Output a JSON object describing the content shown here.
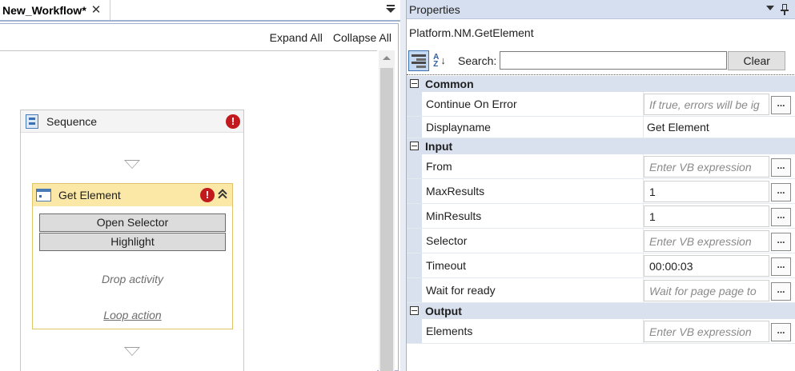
{
  "designer": {
    "tab_title": "New_Workflow*",
    "tab_close": "✕",
    "toolbar": {
      "expand_all": "Expand All",
      "collapse_all": "Collapse All"
    },
    "sequence": {
      "title": "Sequence",
      "error": "!"
    },
    "activity": {
      "title": "Get Element",
      "error": "!",
      "open_selector": "Open Selector",
      "highlight": "Highlight",
      "drop_activity": "Drop activity",
      "loop_action": "Loop action"
    }
  },
  "properties": {
    "panel_title": "Properties",
    "type_name": "Platform.NM.GetElement",
    "search": {
      "label": "Search:",
      "value": "",
      "clear_label": "Clear"
    },
    "ellipsis": "...",
    "categories": [
      {
        "name": "Common",
        "rows": [
          {
            "label": "Continue On Error",
            "value": "If true, errors will be ig",
            "placeholder": true,
            "has_button": true
          },
          {
            "label": "Displayname",
            "value": "Get Element",
            "placeholder": false,
            "has_button": false
          }
        ]
      },
      {
        "name": "Input",
        "rows": [
          {
            "label": "From",
            "value": "Enter VB expression",
            "placeholder": true,
            "has_button": true
          },
          {
            "label": "MaxResults",
            "value": "1",
            "placeholder": false,
            "has_button": true
          },
          {
            "label": "MinResults",
            "value": "1",
            "placeholder": false,
            "has_button": true
          },
          {
            "label": "Selector",
            "value": "Enter VB expression",
            "placeholder": true,
            "has_button": true
          },
          {
            "label": "Timeout",
            "value": "00:00:03",
            "placeholder": false,
            "has_button": true
          },
          {
            "label": "Wait for ready",
            "value": "Wait for page page to",
            "placeholder": true,
            "has_button": true
          }
        ]
      },
      {
        "name": "Output",
        "rows": [
          {
            "label": "Elements",
            "value": "Enter VB expression",
            "placeholder": true,
            "has_button": true
          }
        ]
      }
    ]
  },
  "colors": {
    "error_red": "#c2191e",
    "activity_header": "#fbe8a6",
    "category_band": "#d9e1ee",
    "selection_blue": "#3a6fb2"
  }
}
